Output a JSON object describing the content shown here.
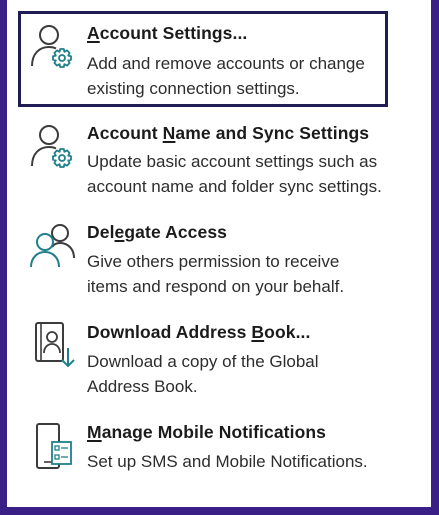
{
  "items": [
    {
      "title_pre": "",
      "title_key": "A",
      "title_post": "ccount Settings...",
      "description": "Add and remove accounts or change\nexisting connection settings.",
      "icon": "account-settings-icon",
      "selected": true
    },
    {
      "title_pre": "Account ",
      "title_key": "N",
      "title_post": "ame and Sync Settings",
      "description": "Update basic account settings such as\naccount name and folder sync settings.",
      "icon": "account-sync-settings-icon",
      "selected": false
    },
    {
      "title_pre": "Del",
      "title_key": "e",
      "title_post": "gate Access",
      "description": "Give others permission to receive\nitems and respond on your behalf.",
      "icon": "delegate-people-icon",
      "selected": false
    },
    {
      "title_pre": "Download Address ",
      "title_key": "B",
      "title_post": "ook...",
      "description": "Download a copy of the Global\nAddress Book.",
      "icon": "address-book-download-icon",
      "selected": false
    },
    {
      "title_pre": "",
      "title_key": "M",
      "title_post": "anage Mobile Notifications",
      "description": "Set up SMS and Mobile Notifications.",
      "icon": "mobile-notifications-icon",
      "selected": false
    }
  ],
  "colors": {
    "frame": "#3a1f86",
    "selection_border": "#201c54",
    "icon_outline": "#3c3c3c",
    "icon_accent": "#1f7f8a"
  }
}
